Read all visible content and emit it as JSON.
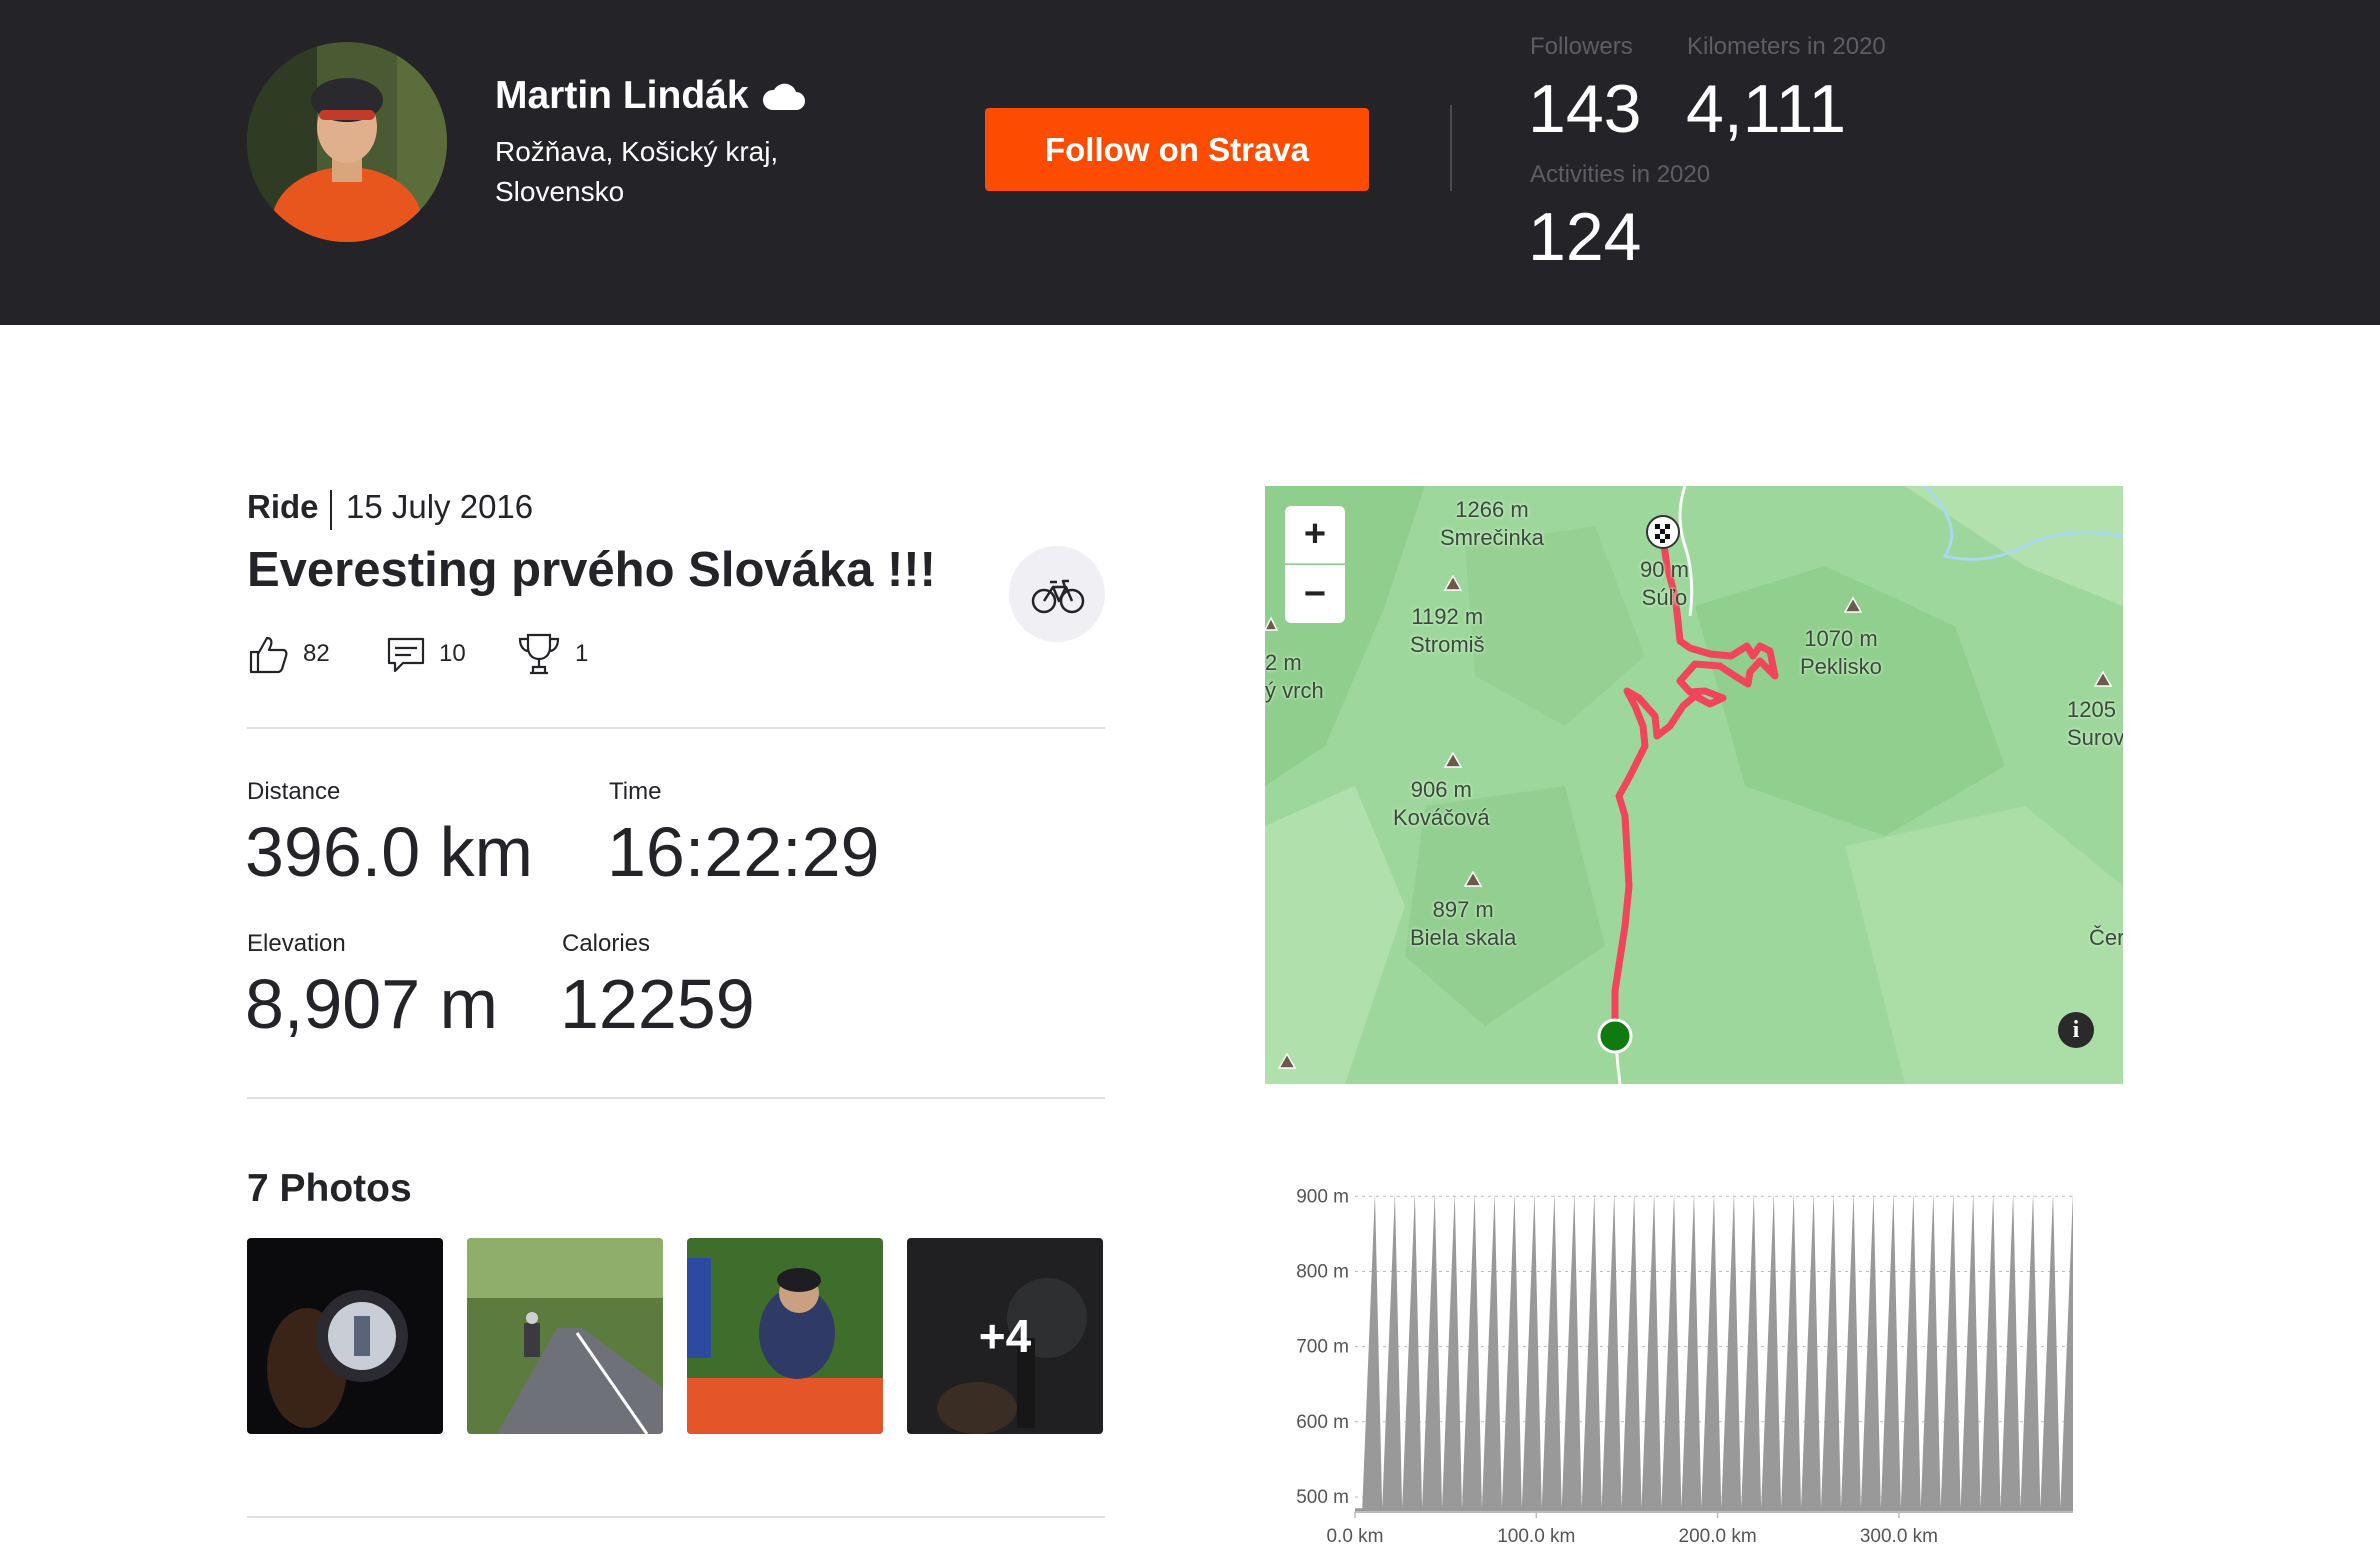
{
  "header": {
    "athlete_name": "Martin Lindák",
    "location_line1": "Rožňava, Košický kraj,",
    "location_line2": "Slovensko",
    "follow_label": "Follow on Strava",
    "stats": {
      "followers_label": "Followers",
      "followers_value": "143",
      "km_label": "Kilometers in 2020",
      "km_value": "4,111",
      "activities_label": "Activities in 2020",
      "activities_value": "124"
    },
    "icons": {
      "status": "cloud-icon"
    }
  },
  "activity": {
    "type": "Ride",
    "date": "15 July 2016",
    "title": "Everesting prvého Slováka !!!",
    "sport_icon": "bicycle-icon",
    "kudos": "82",
    "comments": "10",
    "achievements": "1",
    "stats": {
      "distance_label": "Distance",
      "distance_value": "396.0 km",
      "time_label": "Time",
      "time_value": "16:22:29",
      "elevation_label": "Elevation",
      "elevation_value": "8,907 m",
      "calories_label": "Calories",
      "calories_value": "12259"
    }
  },
  "photos": {
    "heading": "7 Photos",
    "more_label": "+4"
  },
  "map": {
    "zoom_in": "+",
    "zoom_out": "−",
    "info": "i",
    "route_color": "#f0455a",
    "start_color": "#0f7a0f",
    "peaks": [
      {
        "elevation": "1266 m",
        "name": "Smrečinka"
      },
      {
        "elevation": "90 m",
        "name": "Súľo"
      },
      {
        "elevation": "1192 m",
        "name": "Stromiš"
      },
      {
        "elevation": "1070 m",
        "name": "Peklisko"
      },
      {
        "elevation": "2 m",
        "name": "ý vrch"
      },
      {
        "elevation": "1205",
        "name": "Surov"
      },
      {
        "elevation": "906 m",
        "name": "Kováčová"
      },
      {
        "elevation": "897 m",
        "name": "Biela skala"
      },
      {
        "elevation": "",
        "name": "Čer"
      }
    ]
  },
  "chart_data": {
    "type": "area",
    "title": "",
    "xlabel": "",
    "ylabel": "",
    "x_ticks": [
      "0.0 km",
      "100.0 km",
      "200.0 km",
      "300.0 km"
    ],
    "y_ticks": [
      "900 m",
      "800 m",
      "700 m",
      "600 m",
      "500 m"
    ],
    "xlim": [
      0,
      396
    ],
    "ylim": [
      480,
      915
    ],
    "grid": true,
    "fill_color": "#999999",
    "series": [
      {
        "x": [
          0,
          4,
          11,
          15,
          22,
          26,
          33,
          37,
          44,
          48,
          55,
          59,
          66,
          70,
          77,
          81,
          88,
          92,
          99,
          103,
          110,
          114,
          121,
          125,
          132,
          136,
          143,
          147,
          154,
          158,
          165,
          169,
          176,
          180,
          187,
          191,
          198,
          202,
          209,
          213,
          220,
          224,
          231,
          235,
          242,
          246,
          253,
          257,
          264,
          268,
          275,
          279,
          286,
          290,
          297,
          301,
          308,
          312,
          319,
          323,
          330,
          334,
          341,
          345,
          352,
          356,
          363,
          367,
          374,
          378,
          385,
          389,
          396
        ],
        "y": [
          485,
          485,
          905,
          485,
          905,
          485,
          905,
          485,
          905,
          485,
          905,
          485,
          905,
          485,
          905,
          485,
          905,
          485,
          905,
          485,
          905,
          485,
          905,
          485,
          905,
          485,
          905,
          485,
          905,
          485,
          905,
          485,
          905,
          485,
          905,
          485,
          905,
          485,
          905,
          485,
          905,
          485,
          905,
          485,
          905,
          485,
          905,
          485,
          905,
          485,
          905,
          485,
          905,
          485,
          905,
          485,
          905,
          485,
          905,
          485,
          905,
          485,
          905,
          485,
          905,
          485,
          905,
          485,
          905,
          485,
          905,
          485,
          905
        ]
      }
    ]
  }
}
